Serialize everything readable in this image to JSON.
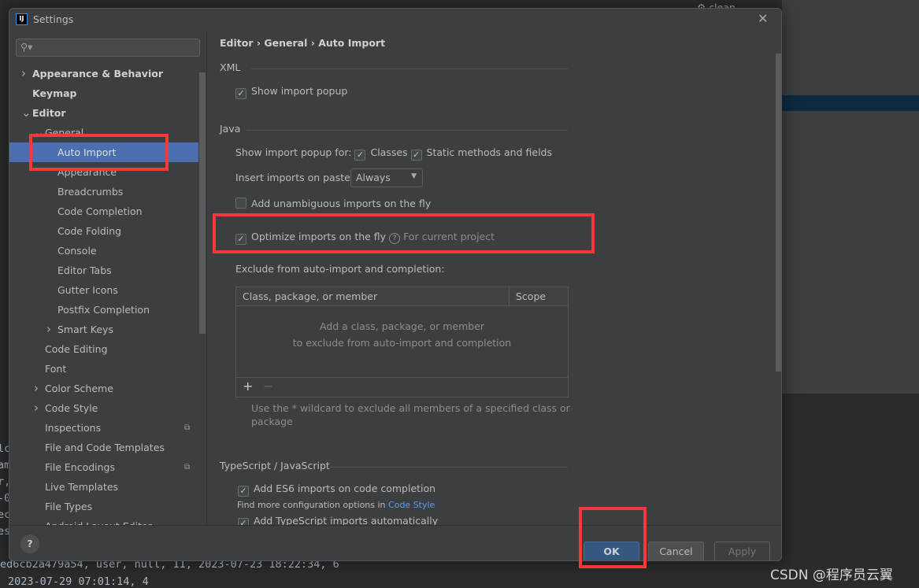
{
  "background": {
    "top_text": "clean",
    "left_fragments": [
      "lc",
      "am",
      "r,",
      "-0",
      "ec",
      "es"
    ],
    "code_lines": [
      "ed6cb2a479a54, user, null, 11, 2023-07-23 18:22:34, 6",
      "2023-07-29 07:01:14, 4"
    ],
    "watermark": "CSDN @程序员云翼"
  },
  "dialog": {
    "title": "Settings",
    "logo": "IJ",
    "search": {
      "placeholder": "",
      "value": ""
    },
    "sidebar": [
      {
        "label": "Appearance & Behavior",
        "level": 0,
        "bold": true,
        "chevron": "right"
      },
      {
        "label": "Keymap",
        "level": 0,
        "bold": true
      },
      {
        "label": "Editor",
        "level": 0,
        "bold": true,
        "chevron": "down"
      },
      {
        "label": "General",
        "level": 1,
        "chevron": "down"
      },
      {
        "label": "Auto Import",
        "level": 2,
        "selected": true
      },
      {
        "label": "Appearance",
        "level": 2
      },
      {
        "label": "Breadcrumbs",
        "level": 2
      },
      {
        "label": "Code Completion",
        "level": 2
      },
      {
        "label": "Code Folding",
        "level": 2
      },
      {
        "label": "Console",
        "level": 2
      },
      {
        "label": "Editor Tabs",
        "level": 2
      },
      {
        "label": "Gutter Icons",
        "level": 2
      },
      {
        "label": "Postfix Completion",
        "level": 2
      },
      {
        "label": "Smart Keys",
        "level": 2,
        "chevron": "right"
      },
      {
        "label": "Code Editing",
        "level": 1
      },
      {
        "label": "Font",
        "level": 1
      },
      {
        "label": "Color Scheme",
        "level": 1,
        "chevron": "right"
      },
      {
        "label": "Code Style",
        "level": 1,
        "chevron": "right"
      },
      {
        "label": "Inspections",
        "level": 1,
        "project_icon": true
      },
      {
        "label": "File and Code Templates",
        "level": 1
      },
      {
        "label": "File Encodings",
        "level": 1,
        "project_icon": true
      },
      {
        "label": "Live Templates",
        "level": 1
      },
      {
        "label": "File Types",
        "level": 1
      },
      {
        "label": "Android Layout Editor",
        "level": 1
      }
    ],
    "breadcrumb": [
      "Editor",
      "General",
      "Auto Import"
    ],
    "xml": {
      "title": "XML",
      "show_popup": {
        "label": "Show import popup",
        "checked": true
      }
    },
    "java": {
      "title": "Java",
      "show_popup_for": "Show import popup for:",
      "classes": {
        "label": "Classes",
        "checked": true
      },
      "static": {
        "label": "Static methods and fields",
        "checked": true
      },
      "insert_label": "Insert imports on paste:",
      "insert_value": "Always",
      "unambiguous": {
        "label": "Add unambiguous imports on the fly",
        "checked": false
      },
      "optimize": {
        "label": "Optimize imports on the fly",
        "checked": true,
        "hint": "For current project"
      },
      "exclude_label": "Exclude from auto-import and completion:",
      "table": {
        "columns": [
          "Class, package, or member",
          "Scope"
        ],
        "empty": [
          "Add a class, package, or member",
          "to exclude from auto-import and completion"
        ]
      },
      "add": "+",
      "remove": "−",
      "wildcard_hint": [
        "Use the * wildcard to exclude all members of a specified class or",
        "package"
      ]
    },
    "ts": {
      "title": "TypeScript / JavaScript",
      "es6": {
        "label": "Add ES6 imports on code completion",
        "checked": true
      },
      "more": "Find more configuration options in ",
      "more_link": "Code Style",
      "ts_auto": {
        "label": "Add TypeScript imports automatically",
        "checked": true
      }
    },
    "footer": {
      "help": "?",
      "ok": "OK",
      "cancel": "Cancel",
      "apply": "Apply"
    }
  },
  "colors": {
    "selection": "#4b6eaf",
    "link": "#589df6",
    "annotation": "#f23a3a",
    "ok": "#365880"
  }
}
